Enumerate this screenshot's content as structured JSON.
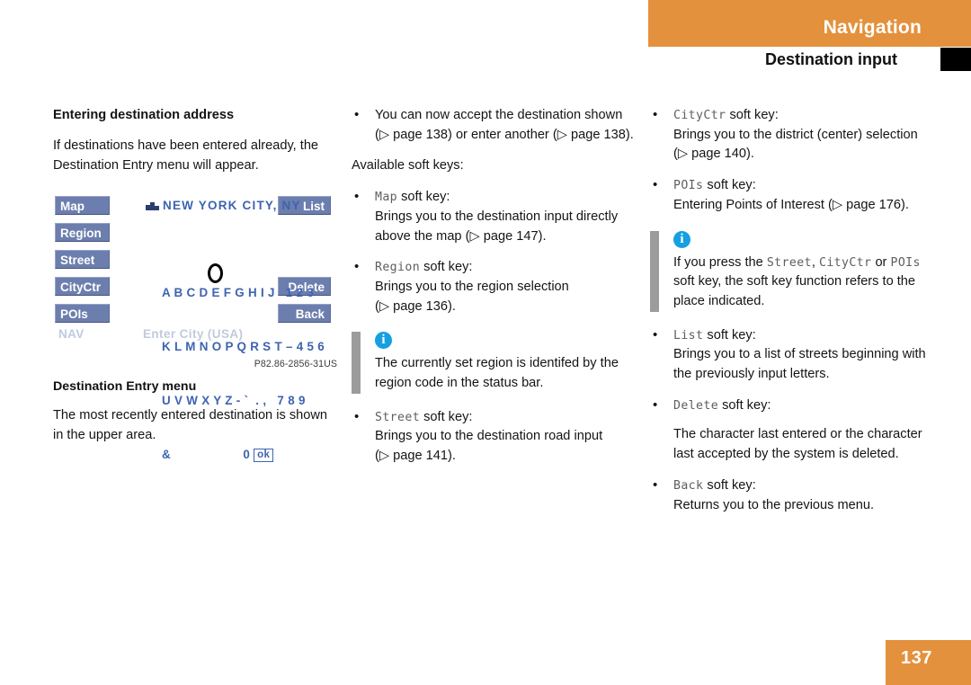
{
  "header": {
    "chapter": "Navigation",
    "section": "Destination input"
  },
  "colors": {
    "accent_orange": "#e3913c",
    "screen_button_blue": "#6c7ead",
    "screen_text_blue": "#3e63b0",
    "info_blue": "#16a0e0",
    "callout_bar_gray": "#9c9c9c"
  },
  "column_left": {
    "title": "Entering destination address",
    "intro": "If destinations have been entered already, the Destination Entry menu will appear.",
    "figure": {
      "buttons_left": [
        "Map",
        "Region",
        "Street",
        "CityCtr",
        "POIs"
      ],
      "buttons_right": [
        "List",
        "Delete",
        "Back"
      ],
      "title_bar": "NEW YORK CITY, NY",
      "title_icon": "city-skyline-icon",
      "keyboard_rows": [
        "A B C D E F G H I J   1 2 3",
        "K L M N O P Q R S T – 4 5 6",
        "U V W X Y Z - `  . ,   7 8 9",
        "&                    0 "
      ],
      "ok_key": "ok",
      "cursor_on_character": "O",
      "status_left": "NAV",
      "status_center": "Enter City (USA)",
      "caption": "P82.86-2856-31US",
      "label": "Destination Entry menu",
      "description": "The most recently entered destination is shown in the upper area."
    }
  },
  "column_middle": {
    "step": {
      "text_1": "You can now accept the destination shown (",
      "ref_1": "▷ page 138",
      "text_2": ") or enter another (",
      "ref_2": "▷ page 138",
      "text_3": ")."
    },
    "available_heading": "Available soft keys:",
    "items": [
      {
        "key": "Map",
        "suffix": " soft key:",
        "body_1": "Brings you to the destination input directly above the map (",
        "ref": "▷ page 147",
        "body_2": ")."
      },
      {
        "key": "Region",
        "suffix": " soft key:",
        "body_1": "Brings you to the region selection (",
        "ref": "▷ page 136",
        "body_2": ")."
      }
    ],
    "callout": {
      "icon": "info-icon",
      "text": "The currently set region is identifed by the region code in the status bar."
    },
    "street_item": {
      "key": "Street",
      "suffix": " soft key:",
      "body_1": "Brings you to the destination road input (",
      "ref": "▷ page 141",
      "body_2": ")."
    }
  },
  "column_right": {
    "items_top": [
      {
        "key": "CityCtr",
        "suffix": " soft key:",
        "body_1": "Brings you to the district (center) selection (",
        "ref": "▷ page 140",
        "body_2": ")."
      },
      {
        "key": "POIs",
        "suffix": " soft key:",
        "body_1": "Entering Points of Interest (",
        "ref": "▷ page 176",
        "body_2": ")."
      }
    ],
    "callout": {
      "icon": "info-icon",
      "text_1": "If you press the ",
      "key_1": "Street",
      "text_2": ", ",
      "key_2": "CityCtr",
      "text_3": " or ",
      "key_3": "POIs",
      "text_4": " soft key, the soft key function refers to the place indicated."
    },
    "items_bottom": [
      {
        "key": "List",
        "suffix": " soft key:",
        "body": "Brings you to a list of streets beginning with the previously input letters."
      },
      {
        "key": "Delete",
        "suffix": " soft key:",
        "body": "The character last entered or the character last accepted by the system is deleted."
      },
      {
        "key": "Back",
        "suffix": " soft key:",
        "body": "Returns you to the previous menu."
      }
    ]
  },
  "footer": {
    "page_number": "137"
  }
}
